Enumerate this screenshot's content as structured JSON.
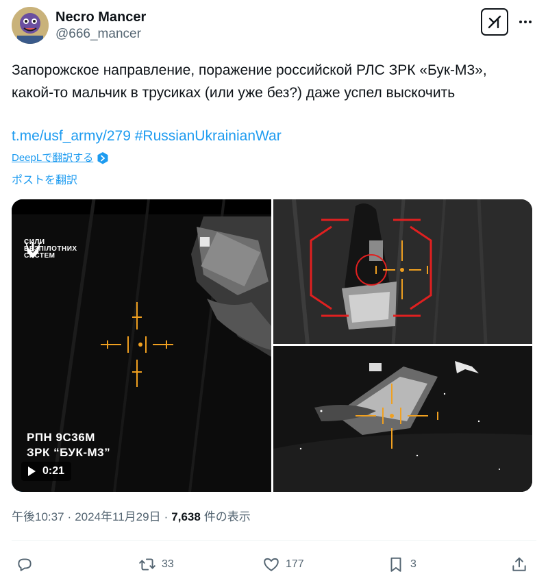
{
  "author": {
    "display_name": "Necro Mancer",
    "handle": "@666_mancer"
  },
  "tweet": {
    "text": "Запорожское направление, поражение российской РЛС ЗРК «Бук-М3», какой-то мальчик в трусиках (или уже без?) даже успел выскочить",
    "link": "t.me/usf_army/279",
    "hashtag": "#RussianUkrainianWar",
    "deepl_label": "DeepLで翻訳する",
    "translate_label": "ポストを翻訳"
  },
  "media": {
    "brand_line1": "СИЛИ",
    "brand_line2": "БЕЗПІЛОТНИХ",
    "brand_line3": "СИСТЕМ",
    "caption_line1": "РПН 9С36М",
    "caption_line2": "ЗРК “БУК-М3”",
    "video_duration": "0:21"
  },
  "meta": {
    "time": "午後10:37",
    "sep1": "·",
    "date": "2024年11月29日",
    "sep2": "·",
    "views": "7,638",
    "views_suffix": "件の表示"
  },
  "actions": {
    "retweets": "33",
    "likes": "177",
    "bookmarks": "3"
  },
  "colors": {
    "link": "#1d9bf0",
    "secondary_text": "#536471",
    "reticle": "#f0a020",
    "target_frame": "#e02020"
  },
  "icons": [
    "avatar",
    "grok-icon",
    "more-icon",
    "deepl-icon",
    "brand-logo-icon",
    "play-icon",
    "reply-icon",
    "retweet-icon",
    "like-icon",
    "bookmark-icon",
    "share-icon"
  ]
}
